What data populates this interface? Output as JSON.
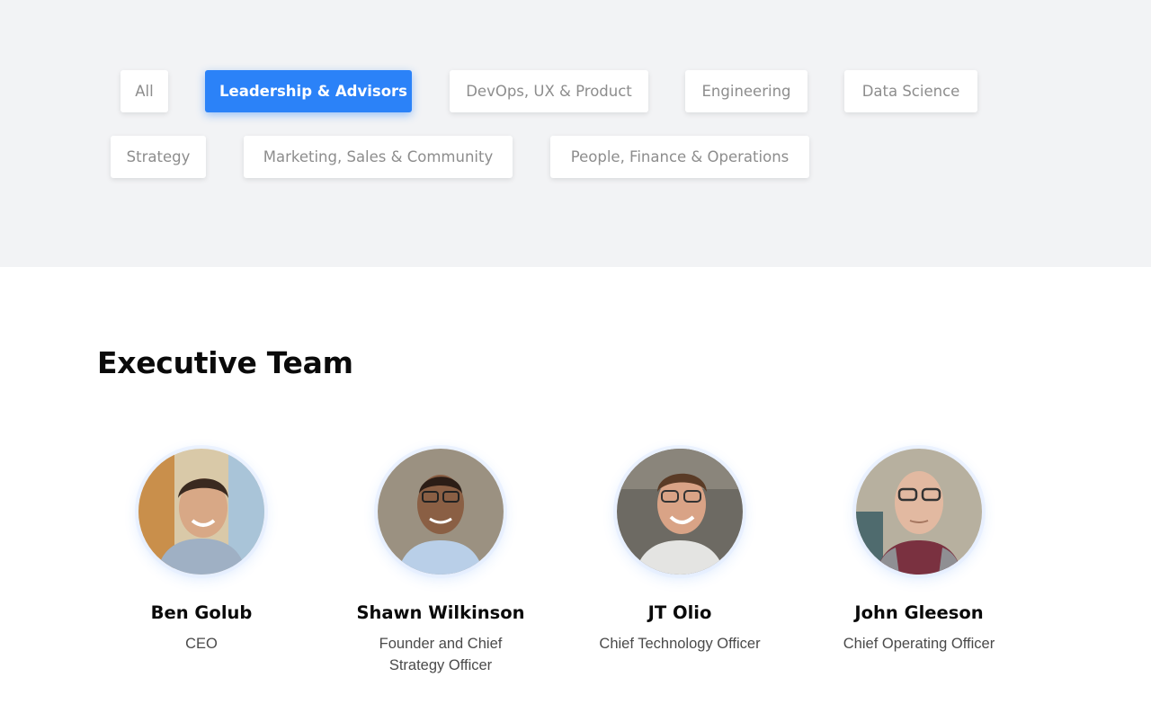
{
  "filters": [
    {
      "label": "All",
      "active": false
    },
    {
      "label": "Leadership & Advisors",
      "active": true
    },
    {
      "label": "DevOps, UX & Product",
      "active": false
    },
    {
      "label": "Engineering",
      "active": false
    },
    {
      "label": "Data Science",
      "active": false
    },
    {
      "label": "Strategy",
      "active": false
    },
    {
      "label": "Marketing, Sales & Community",
      "active": false
    },
    {
      "label": "People, Finance & Operations",
      "active": false
    }
  ],
  "section": {
    "title": "Executive Team"
  },
  "members": [
    {
      "name": "Ben Golub",
      "role": "CEO",
      "avatar_icon": "person-photo"
    },
    {
      "name": "Shawn Wilkinson",
      "role": "Founder and Chief Strategy Officer",
      "avatar_icon": "person-photo"
    },
    {
      "name": "JT Olio",
      "role": "Chief Technology Officer",
      "avatar_icon": "person-photo"
    },
    {
      "name": "John Gleeson",
      "role": "Chief Operating Officer",
      "avatar_icon": "person-photo"
    }
  ],
  "colors": {
    "accent": "#2b82f8",
    "band": "#f2f3f5",
    "inactive_text": "#8d8d8d"
  }
}
